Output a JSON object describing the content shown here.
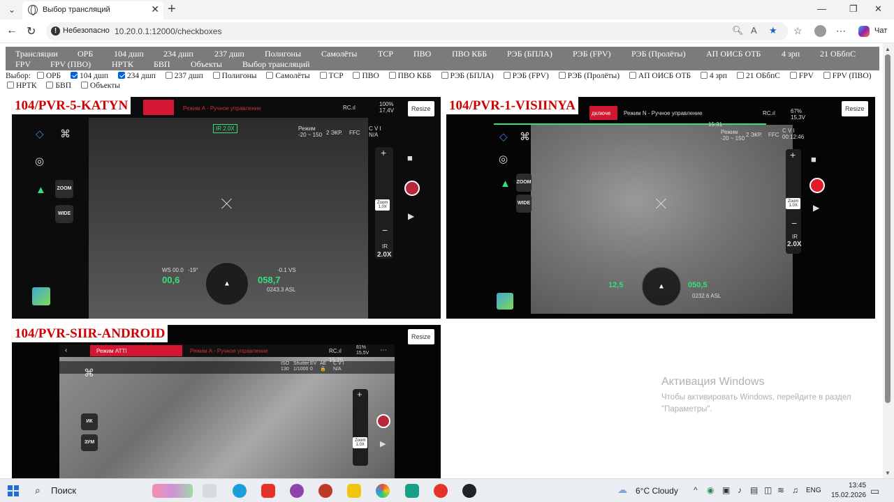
{
  "browser": {
    "tab_title": "Выбор трансляций",
    "insecure_label": "Небезопасно",
    "url": "10.20.0.1:12000/checkboxes",
    "chat_label": "Чат"
  },
  "nav": {
    "items": [
      "Трансляции",
      "ОРБ",
      "104 дшп",
      "234 дшп",
      "237 дшп",
      "Полигоны",
      "Самолёты",
      "ТСР",
      "ПВО",
      "ПВО КББ",
      "РЭБ (БПЛА)",
      "РЭБ (FPV)",
      "РЭБ (Пролёты)",
      "АП ОИСБ ОТБ",
      "4 зрп",
      "21 ОБбпС",
      "FPV",
      "FPV (ПВО)",
      "НРТК",
      "БВП",
      "Объекты",
      "Выбор трансляций"
    ]
  },
  "filter": {
    "label": "Выбор:",
    "options": [
      {
        "label": "ОРБ",
        "checked": false
      },
      {
        "label": "104 дшп",
        "checked": true
      },
      {
        "label": "234 дшп",
        "checked": true
      },
      {
        "label": "237 дшп",
        "checked": false
      },
      {
        "label": "Полигоны",
        "checked": false
      },
      {
        "label": "Самолёты",
        "checked": false
      },
      {
        "label": "ТСР",
        "checked": false
      },
      {
        "label": "ПВО",
        "checked": false
      },
      {
        "label": "ПВО КББ",
        "checked": false
      },
      {
        "label": "РЭБ (БПЛА)",
        "checked": false
      },
      {
        "label": "РЭБ (FPV)",
        "checked": false
      },
      {
        "label": "РЭБ (Пролёты)",
        "checked": false
      },
      {
        "label": "АП ОИСБ ОТБ",
        "checked": false
      },
      {
        "label": "4 зрп",
        "checked": false
      },
      {
        "label": "21 ОБбпС",
        "checked": false
      },
      {
        "label": "FPV",
        "checked": false
      },
      {
        "label": "FPV (ПВО)",
        "checked": false
      },
      {
        "label": "НРТК",
        "checked": false
      },
      {
        "label": "БВП",
        "checked": false
      },
      {
        "label": "Объекты",
        "checked": false
      }
    ]
  },
  "streams": [
    {
      "title": "104/PVR-5-KATYN",
      "resize_label": "Resize",
      "mode": "Режим A - Ручное управление",
      "signal": "RC.ıl",
      "battery": "100%\n17,4V",
      "ir_zoom": "IR 2.0X",
      "range": "Режим\n-20 ~ 150",
      "ekr": "2 ЭКР.",
      "ffc": "FFC",
      "cvi": "C V I\nN/A",
      "zoom_btn": "ZOOM",
      "wide_btn": "WIDE",
      "zoom_label": "Zoom\n1.0X",
      "ir_label": "IR",
      "ir_value": "2.0X",
      "ws": "WS 00.0",
      "tilt": "-19°",
      "hs": "00,6",
      "alt": "058,7",
      "vs": "-0.1 VS",
      "asl": "0243.3 ASL"
    },
    {
      "title": "104/PVR-1-VISIINYA",
      "resize_label": "Resize",
      "mode_left": "дключе",
      "mode": "Режим N - Ручное управление",
      "signal": "RC.ıl",
      "battery": "67%\n15,3V",
      "time": "15:31",
      "range": "Режим\n-20 ~ 150",
      "ekr": "2 ЭКР.",
      "ffc": "FFC",
      "cvi": "C V I\n00:12:46",
      "zoom_btn": "ZOOM",
      "wide_btn": "WIDE",
      "zoom_label": "Zoom\n1.0X",
      "ir_label": "IR",
      "ir_value": "2.0X",
      "hs": "12,5",
      "alt": "050,5",
      "asl": "0232.6 ASL"
    },
    {
      "title": "104/PVR-SIIR-ANDROID",
      "resize_label": "Resize",
      "mode_left": "Режим ATTI",
      "mode": "Режим A - Ручное управление",
      "signal": "RC.ıl",
      "battery": "81%\n15,5V",
      "time": "15:25",
      "iso": "ISO\n130",
      "shutter": "Shutter\n1/1000",
      "ev": "EV\n0",
      "ae": "AE\n🔒",
      "cvi": "C V I\nN/A",
      "ik_btn": "ИК",
      "zum_btn": "ЗУМ",
      "zoom_label": "Zoom\n1.0X"
    }
  ],
  "watermark": {
    "title": "Активация Windows",
    "subtitle": "Чтобы активировать Windows, перейдите в раздел \"Параметры\"."
  },
  "taskbar": {
    "search": "Поиск",
    "weather": "6°C  Cloudy",
    "lang": "ENG",
    "time": "13:45",
    "date": "15.02.2026"
  }
}
